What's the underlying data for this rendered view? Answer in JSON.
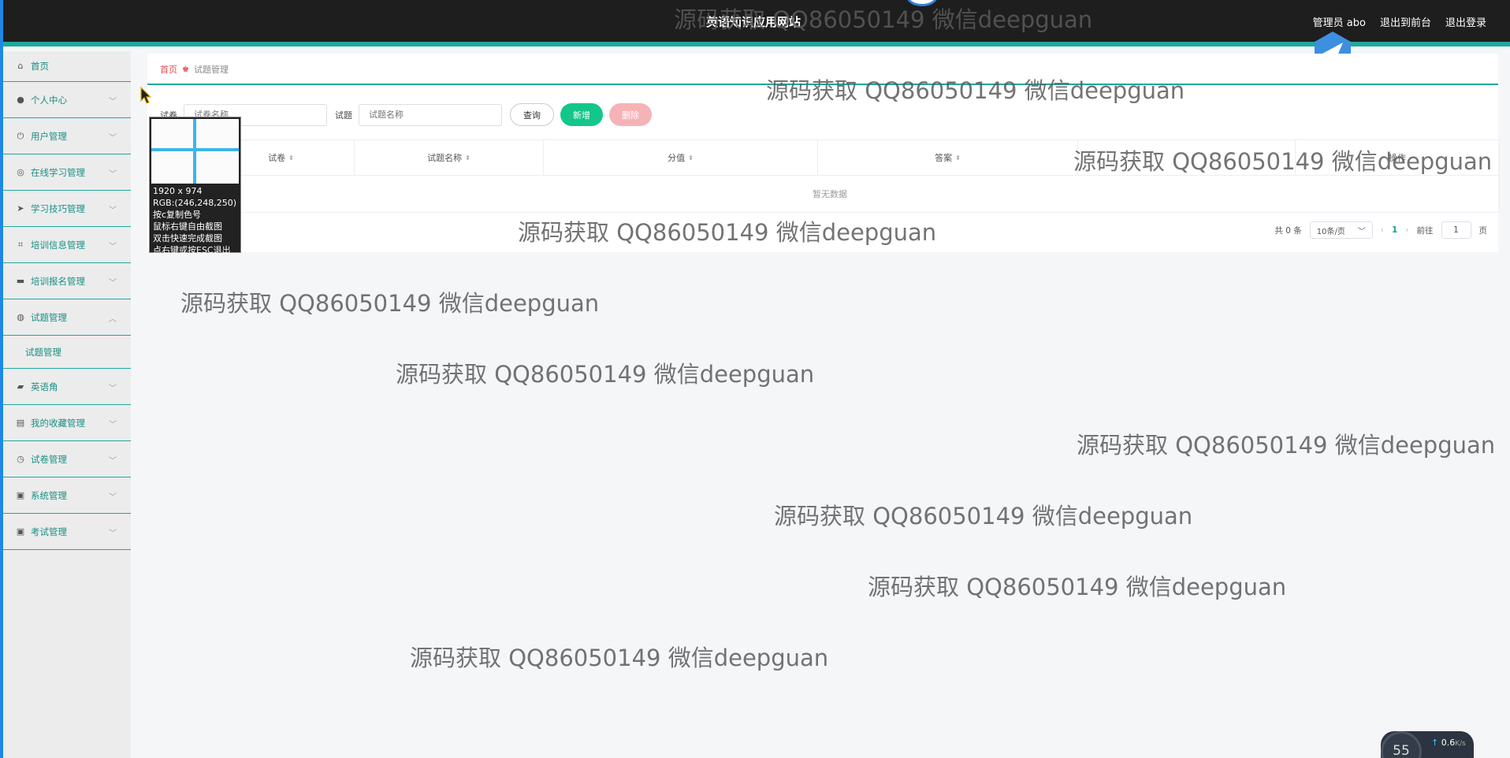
{
  "header": {
    "site_title": "英语知识应用网站",
    "admin_label": "管理员 abo",
    "back_to_front": "退出到前台",
    "logout": "退出登录"
  },
  "sidebar": {
    "items": [
      {
        "label": "首页",
        "icon": "home-icon"
      },
      {
        "label": "个人中心",
        "icon": "user-icon"
      },
      {
        "label": "用户管理",
        "icon": "power-icon"
      },
      {
        "label": "在线学习管理",
        "icon": "compass-icon"
      },
      {
        "label": "学习技巧管理",
        "icon": "send-icon"
      },
      {
        "label": "培训信息管理",
        "icon": "crop-icon"
      },
      {
        "label": "培训报名管理",
        "icon": "chat-icon"
      },
      {
        "label": "试题管理",
        "icon": "globe-icon",
        "expanded": true,
        "children": [
          "试题管理"
        ]
      },
      {
        "label": "英语角",
        "icon": "briefcase-icon"
      },
      {
        "label": "我的收藏管理",
        "icon": "book-icon"
      },
      {
        "label": "试卷管理",
        "icon": "clock-icon"
      },
      {
        "label": "系统管理",
        "icon": "clipboard-icon"
      },
      {
        "label": "考试管理",
        "icon": "clipboard-check-icon"
      }
    ]
  },
  "breadcrumb": {
    "home": "首页",
    "current": "试题管理"
  },
  "filter": {
    "paper_label": "试卷",
    "paper_placeholder": "试卷名称",
    "question_label": "试题",
    "question_placeholder": "试题名称",
    "query_button": "查询",
    "add_button": "新增",
    "delete_button": "删除"
  },
  "table": {
    "columns": [
      "试卷",
      "试题名称",
      "分值",
      "答案",
      "操作"
    ],
    "empty_text": "暂无数据"
  },
  "pagination": {
    "total": "共 0 条",
    "page_size": "10条/页",
    "current_page": "1",
    "goto_label": "前往",
    "goto_value": "1",
    "page_suffix": "页"
  },
  "snip_tool": {
    "dimensions": "1920 x 974",
    "rgb": "RGB:(246,248,250)",
    "hint1": "按c复制色号",
    "hint2": "鼠标右键自由截图",
    "hint3": "双击快速完成截图",
    "hint4": "点右键或按ESC退出"
  },
  "watermark": "源码获取 QQ86050149 微信deepguan",
  "speed_widget": {
    "percent": "55",
    "rate": "0.6",
    "rate_unit": "K/s"
  },
  "colors": {
    "accent_teal": "#1fa89c",
    "add_green": "#13c68a",
    "delete_pink": "#f6b3b7",
    "topbar": "#1e1e1e"
  }
}
